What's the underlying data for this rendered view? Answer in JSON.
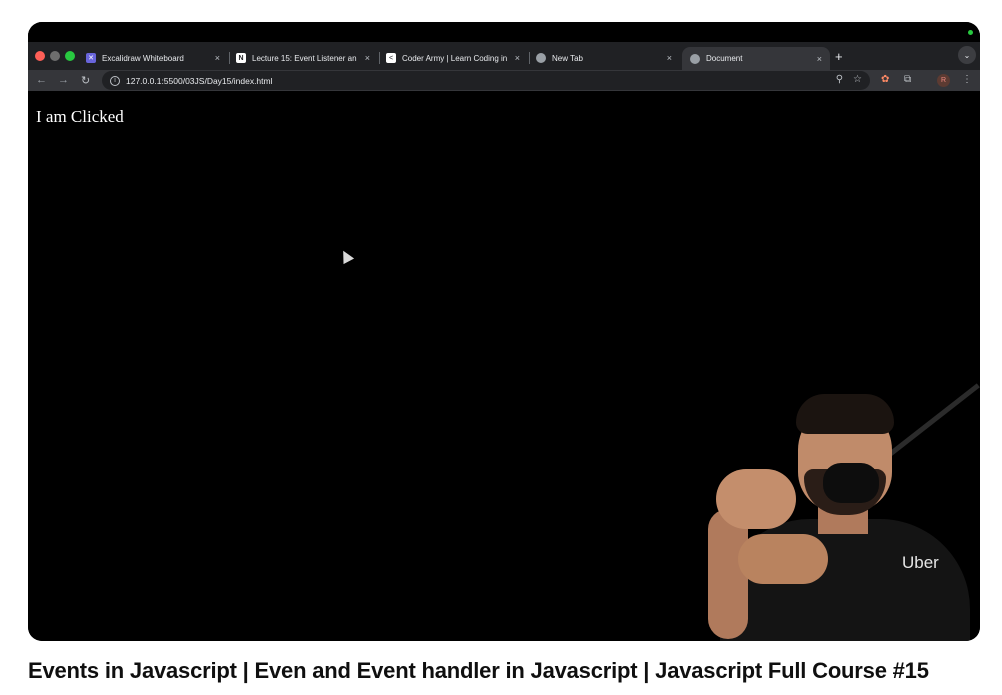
{
  "browser": {
    "tabs": [
      {
        "label": "Excalidraw Whiteboard",
        "icon": "excalidraw-icon",
        "color": "#6965db"
      },
      {
        "label": "Lecture 15: Event Listener an",
        "icon": "notion-icon",
        "color": "#ffffff"
      },
      {
        "label": "Coder Army | Learn Coding in",
        "icon": "coder-army-icon",
        "color": "#ffffff"
      },
      {
        "label": "New Tab",
        "icon": "chrome-icon",
        "color": "#9aa0a6"
      },
      {
        "label": "Document",
        "icon": "globe-icon",
        "color": "#9aa0a6",
        "active": true
      }
    ],
    "close_glyph": "×",
    "new_tab_glyph": "+",
    "tab_menu_glyph": "⌄",
    "url": "127.0.0.1:5500/03JS/Day15/index.html",
    "profile_initial": "R"
  },
  "page": {
    "text": "I am Clicked"
  },
  "presenter": {
    "shirt_logo": "Uber"
  },
  "video": {
    "title": "Events in Javascript | Even and Event handler in Javascript | Javascript Full Course #15"
  }
}
